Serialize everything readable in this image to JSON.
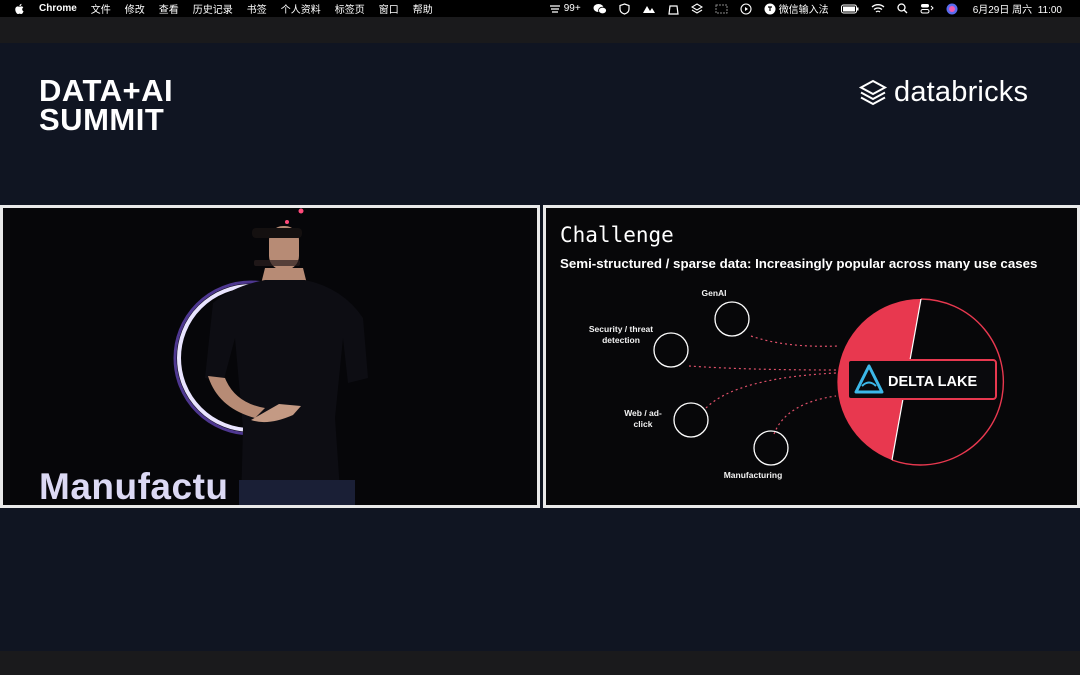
{
  "menubar": {
    "app_name": "Chrome",
    "items": [
      "文件",
      "修改",
      "查看",
      "历史记录",
      "书签",
      "个人资料",
      "标签页",
      "窗口",
      "帮助"
    ],
    "status_count": "99+",
    "input_method": "微信输入法",
    "datetime": "6月29日 周六  11:00"
  },
  "event": {
    "logo_line1": "DATA+AI",
    "logo_line2": "SUMMIT",
    "sponsor": "databricks"
  },
  "video": {
    "caption": "Manufactu"
  },
  "slide": {
    "title": "Challenge",
    "subtitle": "Semi-structured / sparse data: Increasingly popular across many use cases",
    "nodes": [
      {
        "id": "genai",
        "label": "GenAI"
      },
      {
        "id": "security",
        "label": "Security / threat detection"
      },
      {
        "id": "web",
        "label": "Web / ad-click"
      },
      {
        "id": "manufacturing",
        "label": "Manufacturing"
      }
    ],
    "center_label": "DELTA LAKE",
    "colors": {
      "accent": "#e8384f",
      "logo_blue": "#3cb8e8"
    }
  }
}
